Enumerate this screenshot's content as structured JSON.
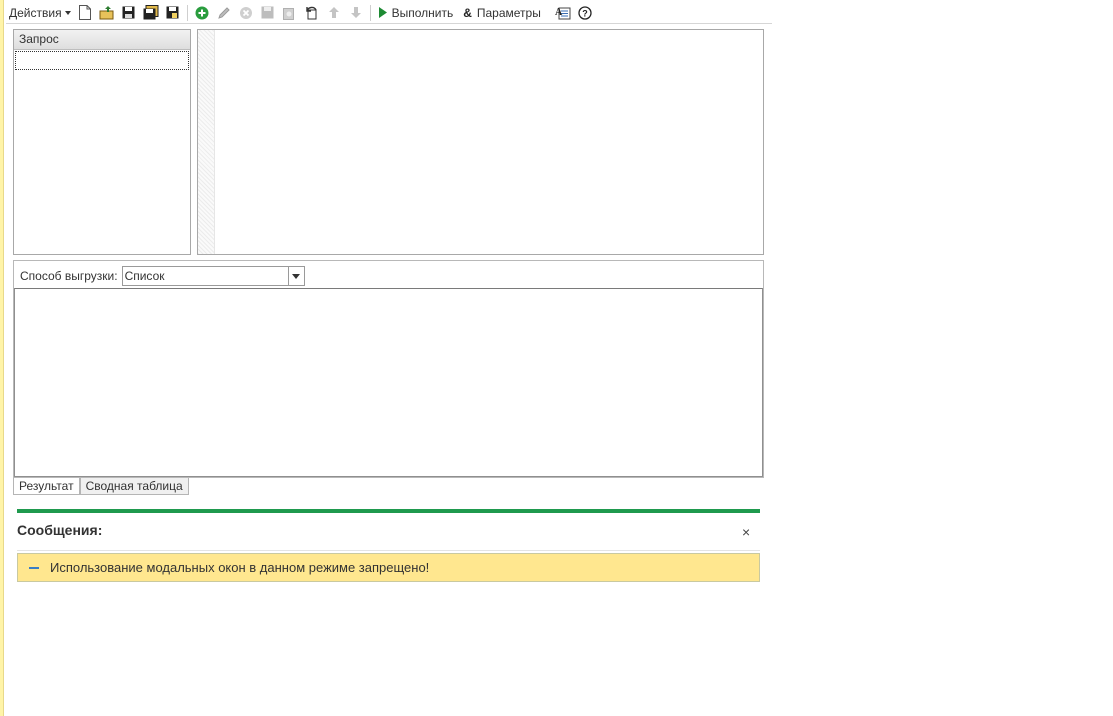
{
  "toolbar": {
    "actions_label": "Действия",
    "execute_label": "Выполнить",
    "parameters_label": "Параметры",
    "icons": [
      "new-document-icon",
      "open-icon",
      "save-icon",
      "save-as-icon",
      "save-disk-icon",
      "add-icon",
      "edit-icon",
      "delete-icon",
      "save-disabled-icon",
      "copy-disabled-icon",
      "undo-icon",
      "move-up-icon",
      "move-down-icon",
      "execute-icon",
      "parameters-icon",
      "query-builder-icon",
      "help-icon"
    ]
  },
  "query_list": {
    "header": "Запрос"
  },
  "result": {
    "unload_label": "Способ выгрузки:",
    "unload_value": "Список",
    "tabs": [
      "Результат",
      "Сводная таблица"
    ]
  },
  "messages": {
    "title": "Сообщения:",
    "close": "×",
    "items": [
      "Использование модальных окон в данном режиме запрещено!"
    ]
  },
  "colors": {
    "accent_green": "#1f9a4e",
    "message_bg": "#ffe78f",
    "left_stripe": "#fff4a8"
  }
}
